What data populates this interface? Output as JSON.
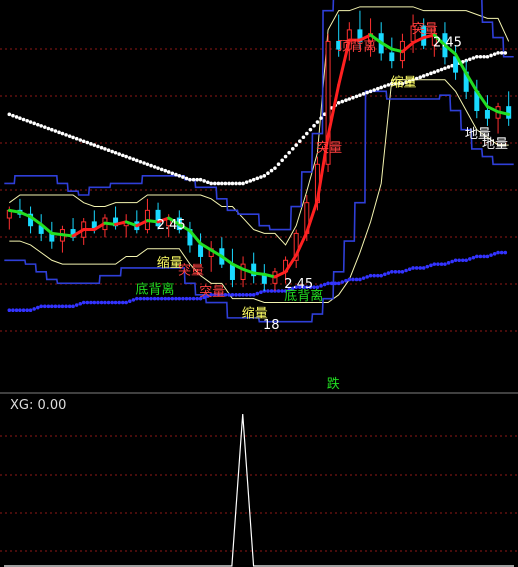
{
  "chart_data": [
    {
      "type": "candlestick",
      "panel": "main",
      "title": "",
      "xlabel": "",
      "ylabel": "",
      "ylim": [
        0,
        100
      ],
      "grid": true,
      "colors": {
        "up": "#ff3030",
        "down": "#19d9ff",
        "rising_line": "#ff2020",
        "trend_line": "#22dd22",
        "band_line": "#2f3fd8",
        "envelope_line": "#f4f4b0",
        "upper_dotted": "#ffffff",
        "lower_dotted": "#3333ff",
        "signal_up_arrow": "#22dd22",
        "grid": "#c0201e"
      },
      "candles": [
        {
          "t": 1,
          "o": 44,
          "h": 47,
          "l": 41,
          "c": 46
        },
        {
          "t": 2,
          "o": 46,
          "h": 49,
          "l": 44,
          "c": 45
        },
        {
          "t": 3,
          "o": 45,
          "h": 47,
          "l": 40,
          "c": 42
        },
        {
          "t": 4,
          "o": 42,
          "h": 45,
          "l": 38,
          "c": 40
        },
        {
          "t": 5,
          "o": 40,
          "h": 43,
          "l": 36,
          "c": 38
        },
        {
          "t": 6,
          "o": 38,
          "h": 42,
          "l": 35,
          "c": 41
        },
        {
          "t": 7,
          "o": 41,
          "h": 44,
          "l": 38,
          "c": 39
        },
        {
          "t": 8,
          "o": 39,
          "h": 44,
          "l": 37,
          "c": 43
        },
        {
          "t": 9,
          "o": 43,
          "h": 46,
          "l": 40,
          "c": 41
        },
        {
          "t": 10,
          "o": 41,
          "h": 45,
          "l": 39,
          "c": 44
        },
        {
          "t": 11,
          "o": 44,
          "h": 47,
          "l": 41,
          "c": 42
        },
        {
          "t": 12,
          "o": 42,
          "h": 45,
          "l": 39,
          "c": 43
        },
        {
          "t": 13,
          "o": 43,
          "h": 46,
          "l": 40,
          "c": 41
        },
        {
          "t": 14,
          "o": 41,
          "h": 49,
          "l": 40,
          "c": 46
        },
        {
          "t": 15,
          "o": 46,
          "h": 48,
          "l": 41,
          "c": 42
        },
        {
          "t": 16,
          "o": 42,
          "h": 45,
          "l": 39,
          "c": 44
        },
        {
          "t": 17,
          "o": 44,
          "h": 46,
          "l": 40,
          "c": 41
        },
        {
          "t": 18,
          "o": 41,
          "h": 43,
          "l": 35,
          "c": 37
        },
        {
          "t": 19,
          "o": 37,
          "h": 40,
          "l": 32,
          "c": 34
        },
        {
          "t": 20,
          "o": 34,
          "h": 38,
          "l": 30,
          "c": 36
        },
        {
          "t": 21,
          "o": 36,
          "h": 39,
          "l": 31,
          "c": 32
        },
        {
          "t": 22,
          "o": 32,
          "h": 36,
          "l": 26,
          "c": 28
        },
        {
          "t": 23,
          "o": 28,
          "h": 34,
          "l": 26,
          "c": 32
        },
        {
          "t": 24,
          "o": 32,
          "h": 35,
          "l": 27,
          "c": 29
        },
        {
          "t": 25,
          "o": 29,
          "h": 32,
          "l": 25,
          "c": 27
        },
        {
          "t": 26,
          "o": 27,
          "h": 31,
          "l": 25,
          "c": 30
        },
        {
          "t": 27,
          "o": 30,
          "h": 34,
          "l": 27,
          "c": 33
        },
        {
          "t": 28,
          "o": 33,
          "h": 41,
          "l": 31,
          "c": 40
        },
        {
          "t": 29,
          "o": 40,
          "h": 50,
          "l": 38,
          "c": 48
        },
        {
          "t": 30,
          "o": 48,
          "h": 60,
          "l": 46,
          "c": 58
        },
        {
          "t": 31,
          "o": 58,
          "h": 92,
          "l": 56,
          "c": 90
        },
        {
          "t": 32,
          "o": 90,
          "h": 97,
          "l": 86,
          "c": 88
        },
        {
          "t": 33,
          "o": 88,
          "h": 95,
          "l": 85,
          "c": 93
        },
        {
          "t": 34,
          "o": 93,
          "h": 98,
          "l": 88,
          "c": 90
        },
        {
          "t": 35,
          "o": 90,
          "h": 96,
          "l": 86,
          "c": 92
        },
        {
          "t": 36,
          "o": 92,
          "h": 95,
          "l": 85,
          "c": 87
        },
        {
          "t": 37,
          "o": 87,
          "h": 91,
          "l": 83,
          "c": 85
        },
        {
          "t": 38,
          "o": 85,
          "h": 92,
          "l": 83,
          "c": 90
        },
        {
          "t": 39,
          "o": 90,
          "h": 97,
          "l": 87,
          "c": 94
        },
        {
          "t": 40,
          "o": 94,
          "h": 96,
          "l": 88,
          "c": 89
        },
        {
          "t": 41,
          "o": 89,
          "h": 94,
          "l": 86,
          "c": 92
        },
        {
          "t": 42,
          "o": 92,
          "h": 95,
          "l": 84,
          "c": 86
        },
        {
          "t": 43,
          "o": 86,
          "h": 89,
          "l": 80,
          "c": 82
        },
        {
          "t": 44,
          "o": 82,
          "h": 85,
          "l": 75,
          "c": 77
        },
        {
          "t": 45,
          "o": 77,
          "h": 80,
          "l": 70,
          "c": 72
        },
        {
          "t": 46,
          "o": 72,
          "h": 76,
          "l": 68,
          "c": 70
        },
        {
          "t": 47,
          "o": 70,
          "h": 74,
          "l": 66,
          "c": 73
        },
        {
          "t": 48,
          "o": 73,
          "h": 77,
          "l": 68,
          "c": 70
        }
      ],
      "series": [
        {
          "values": [
            71,
            70,
            69,
            68,
            67,
            66,
            65,
            64,
            63,
            62,
            61,
            60,
            59,
            58,
            57,
            56,
            55,
            54,
            54,
            53,
            53,
            53,
            53,
            54,
            55,
            57,
            60,
            63,
            66,
            69,
            72,
            74,
            75,
            76,
            77,
            78,
            79,
            79,
            80,
            81,
            82,
            83,
            84,
            85,
            86,
            86,
            87,
            87
          ]
        },
        {
          "values": [
            20,
            20,
            20,
            21,
            21,
            21,
            21,
            22,
            22,
            22,
            22,
            22,
            23,
            23,
            23,
            23,
            23,
            23,
            23,
            24,
            24,
            24,
            24,
            24,
            25,
            25,
            25,
            26,
            26,
            26,
            27,
            27,
            28,
            28,
            29,
            29,
            30,
            30,
            31,
            31,
            32,
            32,
            33,
            33,
            34,
            34,
            35,
            35
          ]
        }
      ],
      "annotations": [
        "顶背离",
        "缩量",
        "缩量",
        "突量",
        "突量",
        "突量",
        "突量",
        "2.45",
        "2.45",
        "2.45",
        "底背离",
        "底背离",
        "缩量",
        "18",
        "地量",
        "地量",
        "跌"
      ]
    },
    {
      "type": "line",
      "panel": "indicator",
      "label": "XG: 0.00",
      "title": "",
      "ylim": [
        0,
        1
      ],
      "x": [
        1,
        2,
        3,
        4,
        5,
        6,
        7,
        8,
        9,
        10,
        11,
        12,
        13,
        14,
        15,
        16,
        17,
        18,
        19,
        20,
        21,
        22,
        23,
        24,
        25,
        26,
        27,
        28,
        29,
        30,
        31,
        32,
        33,
        34,
        35,
        36,
        37,
        38,
        39,
        40,
        41,
        42,
        43,
        44,
        45,
        46,
        47,
        48
      ],
      "values": [
        0,
        0,
        0,
        0,
        0,
        0,
        0,
        0,
        0,
        0,
        0,
        0,
        0,
        0,
        0,
        0,
        0,
        0,
        0,
        0,
        0,
        0,
        1,
        0,
        0,
        0,
        0,
        0,
        0,
        0,
        0,
        0,
        0,
        0,
        0,
        0,
        0,
        0,
        0,
        0,
        0,
        0,
        0,
        0,
        0,
        0,
        0,
        0
      ]
    }
  ]
}
